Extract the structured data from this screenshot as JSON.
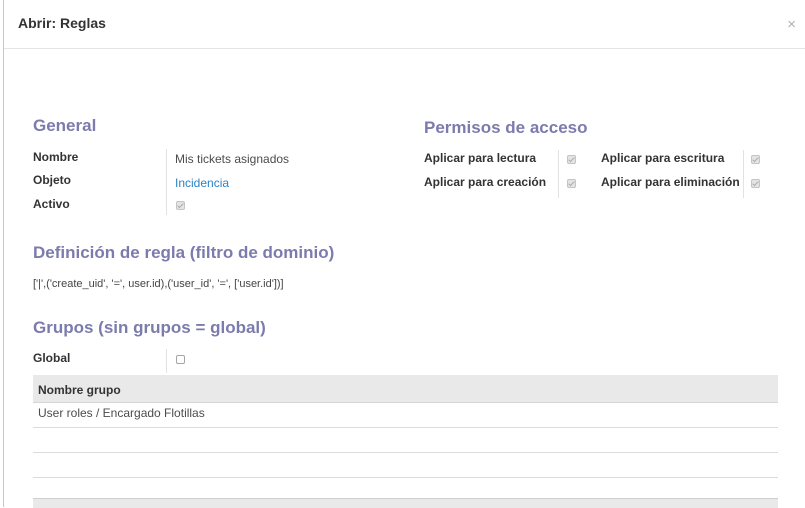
{
  "dialog": {
    "title": "Abrir: Reglas",
    "close_symbol": "×"
  },
  "general": {
    "title": "General",
    "fields": [
      {
        "label": "Nombre",
        "value": "Mis tickets asignados"
      },
      {
        "label": "Objeto",
        "value": "Incidencia"
      },
      {
        "label": "Activo",
        "checked": true
      }
    ]
  },
  "access": {
    "title": "Permisos de acceso",
    "read": {
      "label": "Aplicar para lectura",
      "checked": true
    },
    "create": {
      "label": "Aplicar para creación",
      "checked": true
    },
    "write": {
      "label": "Aplicar para escritura",
      "checked": true
    },
    "delete": {
      "label": "Aplicar para eliminación",
      "checked": true
    }
  },
  "rule": {
    "title": "Definición de regla (filtro de dominio)",
    "domain": "['|',('create_uid', '=', user.id),('user_id', '=', ['user.id'])]"
  },
  "groups": {
    "title": "Grupos (sin grupos = global)",
    "global_label": "Global",
    "global_checked": false,
    "column_header": "Nombre grupo",
    "rows": [
      "User roles / Encargado Flotillas",
      "",
      ""
    ]
  }
}
